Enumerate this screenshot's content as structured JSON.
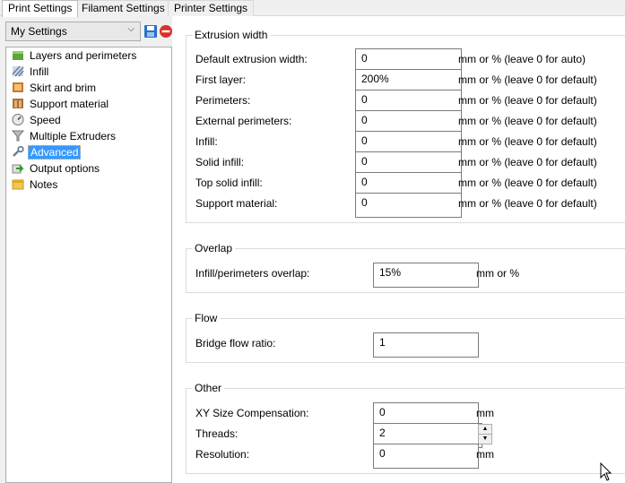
{
  "tabs": [
    {
      "label": "Print Settings",
      "active": true
    },
    {
      "label": "Filament Settings",
      "active": false
    },
    {
      "label": "Printer Settings",
      "active": false
    }
  ],
  "preset": {
    "selected": "My Settings"
  },
  "icons": {
    "save": "save-icon",
    "delete": "delete-icon"
  },
  "tree": [
    {
      "label": "Layers and perimeters",
      "icon": "layers-icon"
    },
    {
      "label": "Infill",
      "icon": "infill-icon"
    },
    {
      "label": "Skirt and brim",
      "icon": "skirt-icon"
    },
    {
      "label": "Support material",
      "icon": "support-icon"
    },
    {
      "label": "Speed",
      "icon": "speed-icon"
    },
    {
      "label": "Multiple Extruders",
      "icon": "funnel-icon"
    },
    {
      "label": "Advanced",
      "icon": "wrench-icon",
      "selected": true
    },
    {
      "label": "Output options",
      "icon": "output-icon"
    },
    {
      "label": "Notes",
      "icon": "notes-icon"
    }
  ],
  "extrusion": {
    "title": "Extrusion width",
    "rows": [
      {
        "label": "Default extrusion width:",
        "value": "0",
        "unit": "mm or % (leave 0 for auto)"
      },
      {
        "label": "First layer:",
        "value": "200%",
        "unit": "mm or % (leave 0 for default)"
      },
      {
        "label": "Perimeters:",
        "value": "0",
        "unit": "mm or % (leave 0 for default)"
      },
      {
        "label": "External perimeters:",
        "value": "0",
        "unit": "mm or % (leave 0 for default)"
      },
      {
        "label": "Infill:",
        "value": "0",
        "unit": "mm or % (leave 0 for default)"
      },
      {
        "label": "Solid infill:",
        "value": "0",
        "unit": "mm or % (leave 0 for default)"
      },
      {
        "label": "Top solid infill:",
        "value": "0",
        "unit": "mm or % (leave 0 for default)"
      },
      {
        "label": "Support material:",
        "value": "0",
        "unit": "mm or % (leave 0 for default)"
      }
    ]
  },
  "overlap": {
    "title": "Overlap",
    "label": "Infill/perimeters overlap:",
    "value": "15%",
    "unit": "mm or %"
  },
  "flow": {
    "title": "Flow",
    "label": "Bridge flow ratio:",
    "value": "1"
  },
  "other": {
    "title": "Other",
    "xy_label": "XY Size Compensation:",
    "xy_value": "0",
    "xy_unit": "mm",
    "threads_label": "Threads:",
    "threads_value": "2",
    "res_label": "Resolution:",
    "res_value": "0",
    "res_unit": "mm"
  },
  "colors": {
    "selection": "#3399ff",
    "delete_red": "#d9302c",
    "save_blue": "#2a6fc9"
  }
}
